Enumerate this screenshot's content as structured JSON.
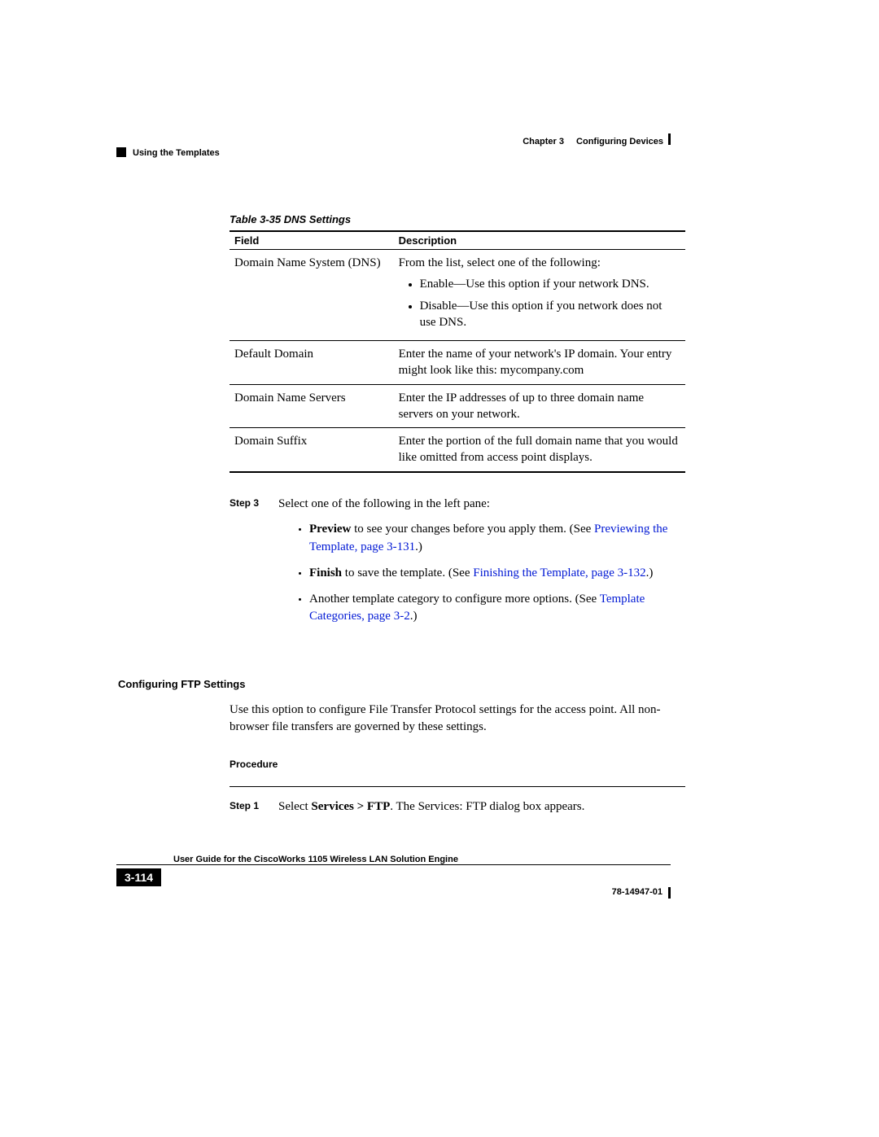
{
  "header": {
    "chapter_label": "Chapter 3",
    "chapter_title": "Configuring Devices",
    "section_path": "Using the Templates"
  },
  "table": {
    "caption": "Table 3-35    DNS Settings",
    "head_field": "Field",
    "head_desc": "Description",
    "rows": [
      {
        "field": "Domain Name System (DNS)",
        "desc_intro": "From the list, select one of the following:",
        "opts": [
          "Enable—Use this option if your network DNS.",
          "Disable—Use this option if you network does not use DNS."
        ]
      },
      {
        "field": "Default Domain",
        "desc": "Enter the name of your network's IP domain. Your entry might look like this: mycompany.com"
      },
      {
        "field": "Domain Name Servers",
        "desc": "Enter the IP addresses of up to three domain name servers on your network."
      },
      {
        "field": "Domain Suffix",
        "desc": "Enter the portion of the full domain name that you would like omitted from access point displays."
      }
    ]
  },
  "step3": {
    "label": "Step 3",
    "intro": "Select one of the following in the left pane:",
    "bullets": {
      "b1": {
        "bold": "Preview",
        "text1": " to see your changes before you apply them. (See ",
        "link": "Previewing the Template, page 3-131",
        "text2": ".)"
      },
      "b2": {
        "bold": "Finish",
        "text1": " to save the template. (See ",
        "link": "Finishing the Template, page 3-132",
        "text2": ".)"
      },
      "b3": {
        "text1": "Another template category to configure more options. (See ",
        "link": "Template Categories, page 3-2",
        "text2": ".)"
      }
    }
  },
  "ftp": {
    "heading": "Configuring FTP Settings",
    "para": "Use this option to configure File Transfer Protocol settings for the access point. All non-browser file transfers are governed by these settings.",
    "proc_label": "Procedure"
  },
  "step1": {
    "label": "Step 1",
    "text1": "Select ",
    "bold": "Services > FTP",
    "text2": ". The Services: FTP dialog box appears."
  },
  "footer": {
    "page": "3-114",
    "title": "User Guide for the CiscoWorks 1105 Wireless LAN Solution Engine",
    "docnum": "78-14947-01"
  }
}
